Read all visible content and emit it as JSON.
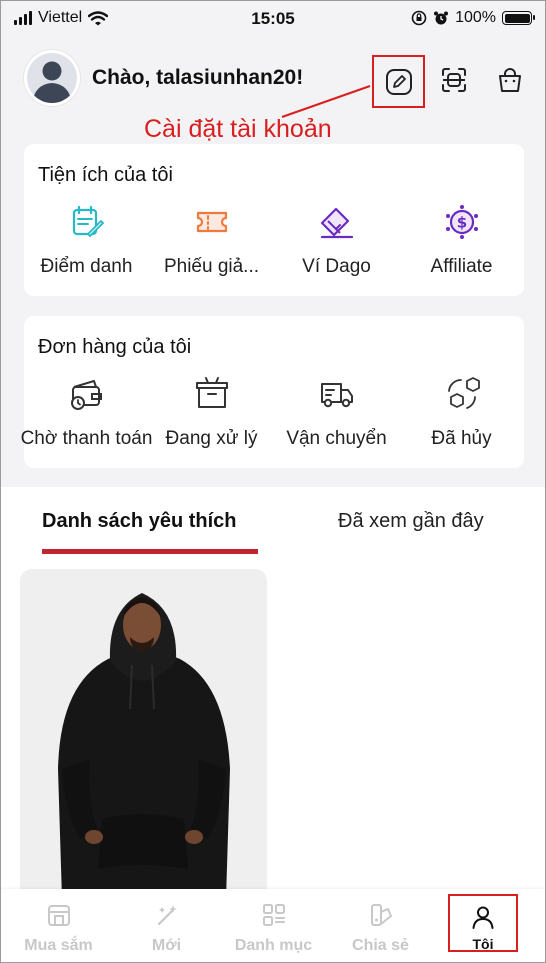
{
  "status_bar": {
    "carrier": "Viettel",
    "time": "15:05",
    "battery": "100%"
  },
  "header": {
    "greeting": "Chào, talasiunhan20!",
    "annotation": "Cài đặt tài khoản"
  },
  "utilities": {
    "title": "Tiện ích của tôi",
    "items": [
      {
        "label": "Điểm danh",
        "icon": "calendar-check-icon",
        "color": "#28b8c7"
      },
      {
        "label": "Phiếu giả...",
        "icon": "voucher-ticket-icon",
        "color": "#f07a3c"
      },
      {
        "label": "Ví Dago",
        "icon": "wallet-card-icon",
        "color": "#6a2bc2"
      },
      {
        "label": "Affiliate",
        "icon": "affiliate-dollar-icon",
        "color": "#6a2bc2"
      }
    ]
  },
  "orders": {
    "title": "Đơn hàng của tôi",
    "items": [
      {
        "label": "Chờ thanh toán",
        "icon": "wallet-pending-icon"
      },
      {
        "label": "Đang xử lý",
        "icon": "package-processing-icon"
      },
      {
        "label": "Vận chuyển",
        "icon": "delivery-truck-icon"
      },
      {
        "label": "Đã hủy",
        "icon": "cancelled-box-icon"
      }
    ]
  },
  "tabs": [
    {
      "label": "Danh sách yêu thích",
      "active": true
    },
    {
      "label": "Đã xem gần đây",
      "active": false
    }
  ],
  "bottom_nav": [
    {
      "label": "Mua sắm",
      "icon": "shop-icon"
    },
    {
      "label": "Mới",
      "icon": "magic-wand-icon"
    },
    {
      "label": "Danh mục",
      "icon": "category-grid-icon"
    },
    {
      "label": "Chia sẻ",
      "icon": "share-icon"
    },
    {
      "label": "Tôi",
      "icon": "user-icon",
      "active": true
    }
  ],
  "colors": {
    "accent_red": "#c0262d",
    "annotation_red": "#d81e1e"
  }
}
